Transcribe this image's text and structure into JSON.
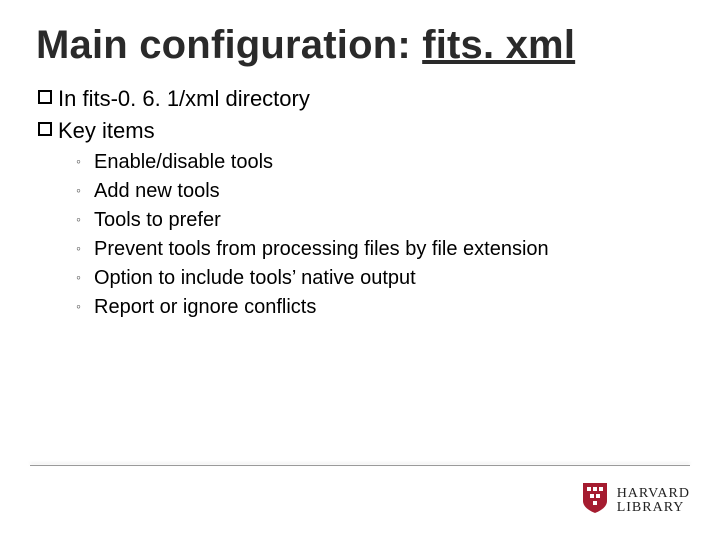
{
  "title": {
    "plain": "Main configuration: ",
    "link": "fits. xml"
  },
  "top_bullets": [
    "In fits-0. 6. 1/xml directory",
    "Key items"
  ],
  "sub_bullets": [
    "Enable/disable tools",
    "Add new tools",
    "Tools to prefer",
    "Prevent tools from processing files by file extension",
    "Option to include tools’ native output",
    "Report or ignore conflicts"
  ],
  "logo": {
    "line1": "HARVARD",
    "line2": "LIBRARY"
  }
}
